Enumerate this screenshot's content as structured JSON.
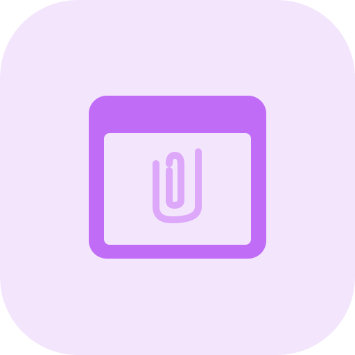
{
  "icon": {
    "name": "browser-window-attachment-icon",
    "glyph": "paperclip-icon"
  },
  "colors": {
    "background": "#F3E6FC",
    "window_frame": "#C06CF7",
    "window_body": "#F3E6FC",
    "paperclip": "#DDA7FA"
  }
}
